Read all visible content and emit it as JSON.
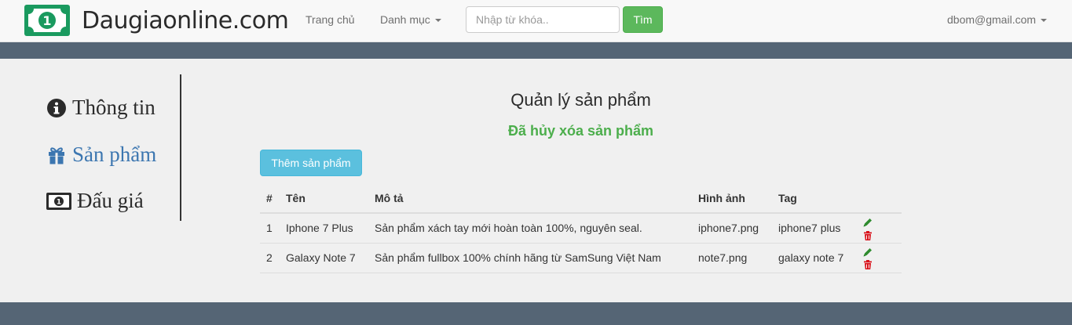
{
  "brand": {
    "name": "Daugiaonline.com",
    "logo_icon": "banknote-icon",
    "logo_color": "#1a9a5f"
  },
  "nav": {
    "home": "Trang chủ",
    "category": "Danh mục"
  },
  "search": {
    "placeholder": "Nhập từ khóa..",
    "value": "",
    "button": "Tìm"
  },
  "user": {
    "email": "dbom@gmail.com"
  },
  "sidebar": {
    "items": [
      {
        "label": "Thông tin",
        "icon": "info-circle-icon",
        "active": false
      },
      {
        "label": "Sản phẩm",
        "icon": "gift-icon",
        "active": true
      },
      {
        "label": "Đấu giá",
        "icon": "banknote-icon",
        "active": false
      }
    ]
  },
  "main": {
    "title": "Quản lý sản phẩm",
    "status": "Đã hủy xóa sản phẩm",
    "add_button": "Thêm sản phẩm"
  },
  "table": {
    "headers": [
      "#",
      "Tên",
      "Mô tả",
      "Hình ảnh",
      "Tag"
    ],
    "rows": [
      [
        "1",
        "Iphone 7 Plus",
        "Sản phẩm xách tay mới hoàn toàn 100%, nguyên seal.",
        "iphone7.png",
        "iphone7 plus"
      ],
      [
        "2",
        "Galaxy Note 7",
        "Sản phẩm fullbox 100% chính hãng từ SamSung Việt Nam",
        "note7.png",
        "galaxy note 7"
      ]
    ],
    "row_actions": [
      "pencil-icon",
      "trash-icon"
    ]
  },
  "colors": {
    "band": "#556575",
    "success": "#5cb85c",
    "info": "#5bc0de",
    "active_link": "#3c76b0",
    "edit_icon": "#2e8b2e",
    "delete_icon": "#d9121b"
  }
}
